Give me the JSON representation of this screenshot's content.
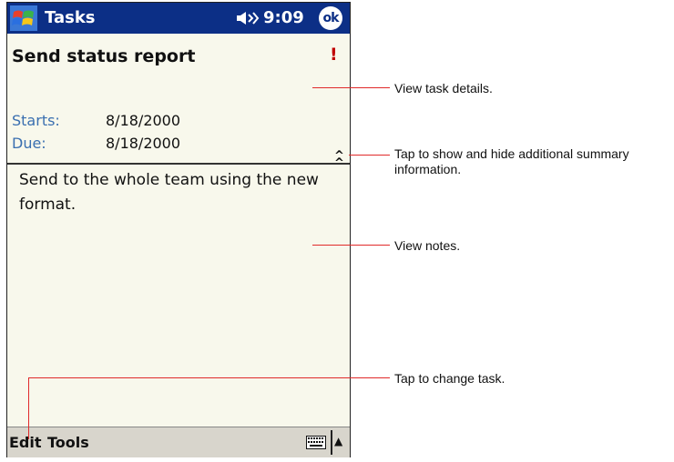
{
  "titlebar": {
    "app_title": "Tasks",
    "time": "9:09",
    "ok_label": "ok"
  },
  "task": {
    "subject": "Send status report",
    "priority_mark": "!",
    "starts_label": "Starts:",
    "starts_value": "8/18/2000",
    "due_label": "Due:",
    "due_value": "8/18/2000",
    "toggle_symbol": "^",
    "notes": "Send to the whole team using the new format."
  },
  "menu": {
    "edit": "Edit",
    "tools": "Tools",
    "sip_arrow": "▲"
  },
  "callouts": [
    "View task details.",
    "Tap to show and hide additional summary information.",
    "View notes.",
    "Tap to change task."
  ],
  "colors": {
    "titlebar": "#0c2f86",
    "label_blue": "#3a6fb0",
    "callout_line": "#e02a2a",
    "priority": "#c00000"
  },
  "icons": [
    "windows-start-icon",
    "speaker-icon",
    "priority-icon",
    "toggle-summary-icon",
    "keyboard-icon",
    "sip-arrow-icon"
  ]
}
